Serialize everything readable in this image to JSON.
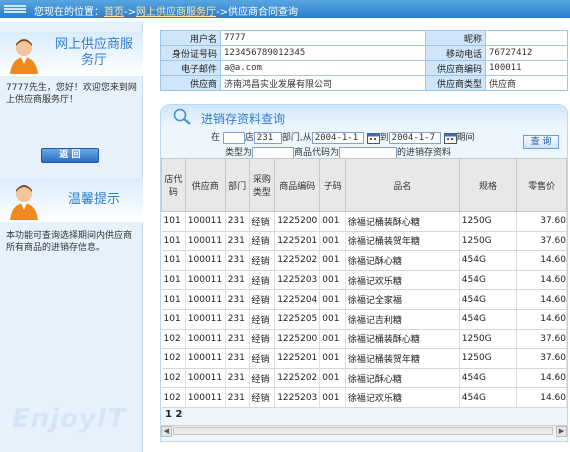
{
  "breadcrumb": {
    "prefix": "您现在的位置：",
    "home": "首页",
    "sep1": "->",
    "section": "网上供应商服务厅",
    "sep2": "->",
    "current": "供应商合同查询"
  },
  "sidebar": {
    "service_title": "网上供应商服务厅",
    "greeting": "7777先生，您好！欢迎您来到网上供应商服务厅！",
    "back_label": "返 回",
    "tips_title": "温馨提示",
    "tips_text": "本功能可查询选择期间内供应商所有商品的进销存信息。",
    "watermark": "EnjoyIT"
  },
  "info": {
    "username_label": "用户名",
    "username": "7777",
    "nickname_label": "昵称",
    "nickname": "",
    "idcard_label": "身份证号码",
    "idcard": "123456789012345",
    "phone_label": "移动电话",
    "phone": "76727412",
    "email_label": "电子邮件",
    "email": "a@a.com",
    "supplier_code_label": "供应商编码",
    "supplier_code": "100011",
    "supplier_label": "供应商",
    "supplier": "济南鸿昌实业发展有限公司",
    "supplier_type_label": "供应商类型",
    "supplier_type": "供应商"
  },
  "query": {
    "panel_title": "进销存资料查询",
    "in_label": "在",
    "store_value": "",
    "store_label": "店",
    "dept_value": "231",
    "dept_label": "部门,从",
    "date_from": "2004-1-1",
    "to_label": "到",
    "date_to": "2004-1-7",
    "period_label": "期间",
    "type_label": "类型为",
    "type_value": "",
    "code_label": "商品代码为",
    "code_value": "",
    "suffix_label": "的进销存资料",
    "query_button": "查 询"
  },
  "grid": {
    "headers": [
      "店代码",
      "供应商",
      "部门",
      "采购类型",
      "商品编码",
      "子码",
      "品名",
      "规格",
      "零售价"
    ],
    "rows": [
      [
        "101",
        "100011",
        "231",
        "经销",
        "1225200",
        "001",
        "徐福记桶装酥心糖",
        "1250G",
        "37.60"
      ],
      [
        "101",
        "100011",
        "231",
        "经销",
        "1225201",
        "001",
        "徐福记桶装贺年糖",
        "1250G",
        "37.60"
      ],
      [
        "101",
        "100011",
        "231",
        "经销",
        "1225202",
        "001",
        "徐福记酥心糖",
        "454G",
        "14.60"
      ],
      [
        "101",
        "100011",
        "231",
        "经销",
        "1225203",
        "001",
        "徐福记欢乐糖",
        "454G",
        "14.60"
      ],
      [
        "101",
        "100011",
        "231",
        "经销",
        "1225204",
        "001",
        "徐福记全家福",
        "454G",
        "14.60"
      ],
      [
        "101",
        "100011",
        "231",
        "经销",
        "1225205",
        "001",
        "徐福记吉利糖",
        "454G",
        "14.60"
      ],
      [
        "102",
        "100011",
        "231",
        "经销",
        "1225200",
        "001",
        "徐福记桶装酥心糖",
        "1250G",
        "37.60"
      ],
      [
        "102",
        "100011",
        "231",
        "经销",
        "1225201",
        "001",
        "徐福记桶装贺年糖",
        "1250G",
        "37.60"
      ],
      [
        "102",
        "100011",
        "231",
        "经销",
        "1225202",
        "001",
        "徐福记酥心糖",
        "454G",
        "14.60"
      ],
      [
        "102",
        "100011",
        "231",
        "经销",
        "1225203",
        "001",
        "徐福记欢乐糖",
        "454G",
        "14.60"
      ]
    ],
    "pages": [
      "1",
      "2"
    ]
  }
}
